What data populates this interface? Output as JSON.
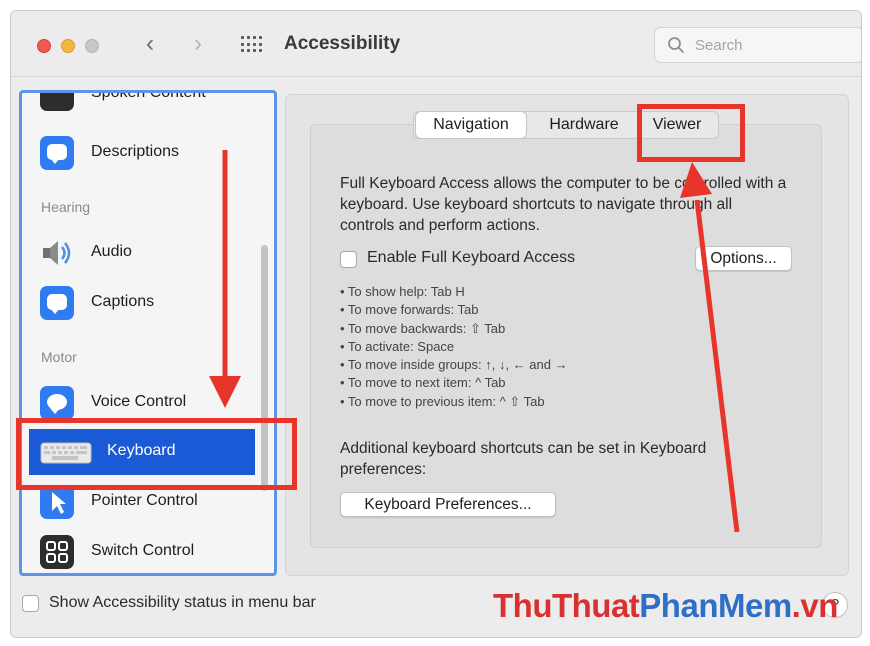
{
  "window": {
    "title": "Accessibility",
    "search_placeholder": "Search"
  },
  "sidebar": {
    "partial_item": "Spoken Content",
    "sections": [
      {
        "heading": "Hearing"
      },
      {
        "heading": "Motor"
      }
    ],
    "items": [
      {
        "label": "Descriptions",
        "icon": "speech-bubble-icon"
      },
      {
        "label": "Audio",
        "icon": "speaker-icon"
      },
      {
        "label": "Captions",
        "icon": "captions-icon"
      },
      {
        "label": "Voice Control",
        "icon": "voice-control-icon"
      },
      {
        "label": "Keyboard",
        "icon": "keyboard-icon",
        "selected": true
      },
      {
        "label": "Pointer Control",
        "icon": "pointer-icon"
      },
      {
        "label": "Switch Control",
        "icon": "switch-control-icon"
      }
    ]
  },
  "tabs": [
    {
      "label": "Navigation",
      "active": true
    },
    {
      "label": "Hardware",
      "active": false
    },
    {
      "label": "Viewer",
      "active": false
    }
  ],
  "main": {
    "description": "Full Keyboard Access allows the computer to be controlled with a keyboard. Use keyboard shortcuts to navigate through all controls and perform actions.",
    "enable_checkbox_label": "Enable Full Keyboard Access",
    "enable_checked": false,
    "options_button": "Options...",
    "hints": [
      "• To show help: Tab H",
      "• To move forwards: Tab",
      "• To move backwards: ⇧ Tab",
      "• To activate: Space",
      "• To move inside groups: ↑, ↓, ← and →",
      "• To move to next item: ^ Tab",
      "• To move to previous item: ^ ⇧ Tab"
    ],
    "additional_text": "Additional keyboard shortcuts can be set in Keyboard preferences:",
    "keyboard_prefs_button": "Keyboard Preferences..."
  },
  "footer": {
    "status_checkbox_label": "Show Accessibility status in menu bar",
    "status_checked": false,
    "help_button": "?"
  },
  "watermark": {
    "part1": "ThuThuat",
    "part2": "PhanMem",
    "part3": ".vn"
  },
  "colors": {
    "accent": "#1b5ad6",
    "annotation": "#e8352b",
    "sidebar_border": "#5f93e8"
  }
}
